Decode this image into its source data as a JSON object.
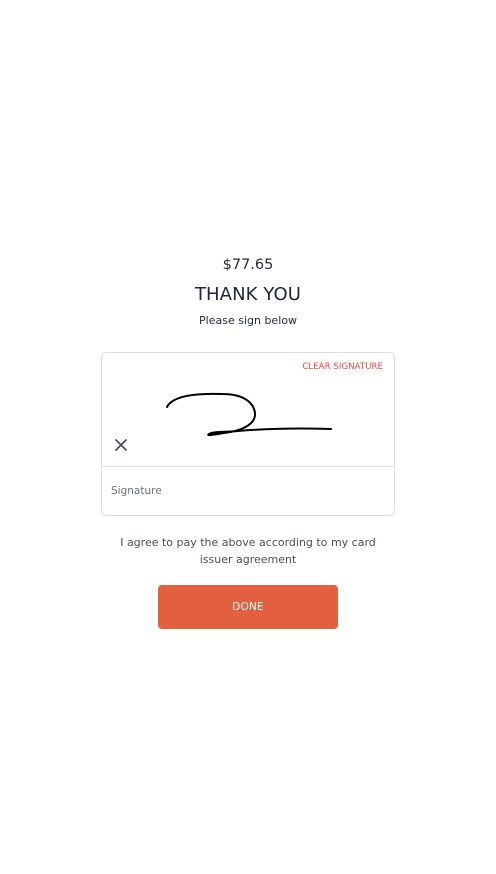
{
  "receipt": {
    "amount": "$77.65",
    "title": "THANK YOU",
    "subtitle": "Please sign below"
  },
  "signature_card": {
    "clear_label": "CLEAR SIGNATURE",
    "field_label": "Signature",
    "close_icon": "close-icon"
  },
  "agreement": {
    "line1": "I agree to pay the above according to my card",
    "line2": "issuer agreement"
  },
  "actions": {
    "done_label": "DONE"
  },
  "colors": {
    "accent": "#e2603f",
    "clear_text": "#ec4b3d",
    "text_primary": "#1f2440"
  }
}
